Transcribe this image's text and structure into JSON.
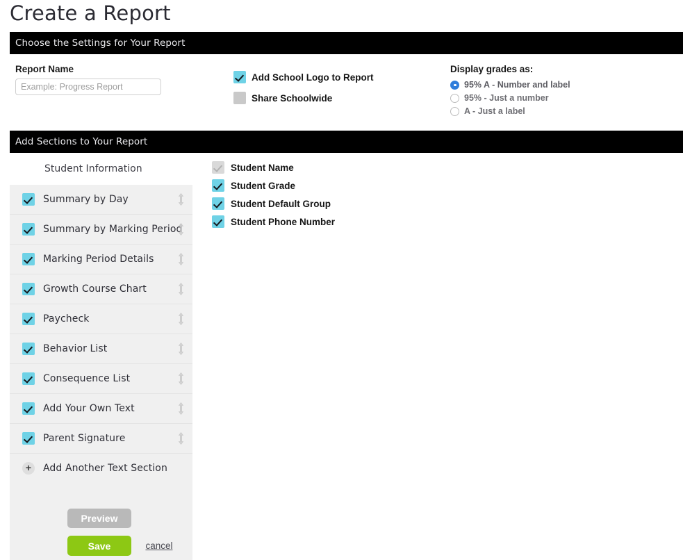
{
  "page": {
    "title": "Create a Report"
  },
  "settings_section": {
    "bar_title": "Choose the Settings for Your Report",
    "report_name_label": "Report Name",
    "report_name_value": "",
    "report_name_placeholder": "Example: Progress Report",
    "options": [
      {
        "label": "Add School Logo to Report",
        "checked": true
      },
      {
        "label": "Share Schoolwide",
        "checked": false
      }
    ],
    "grades": {
      "title": "Display grades as:",
      "options": [
        {
          "label": "95% A - Number and label",
          "selected": true
        },
        {
          "label": "95% - Just a number",
          "selected": false
        },
        {
          "label": "A - Just a label",
          "selected": false
        }
      ]
    }
  },
  "sections_section": {
    "bar_title": "Add Sections to Your Report",
    "sidebar_head": "Student Information",
    "items": [
      {
        "label": "Summary by Day",
        "checked": true
      },
      {
        "label": "Summary by Marking Period",
        "checked": true
      },
      {
        "label": "Marking Period Details",
        "checked": true
      },
      {
        "label": "Growth Course Chart",
        "checked": true
      },
      {
        "label": "Paycheck",
        "checked": true
      },
      {
        "label": "Behavior List",
        "checked": true
      },
      {
        "label": "Consequence List",
        "checked": true
      },
      {
        "label": "Add Your Own Text",
        "checked": true
      },
      {
        "label": "Parent Signature",
        "checked": true
      }
    ],
    "add_another_label": "Add Another Text Section",
    "add_another_icon": "plus-icon"
  },
  "fields_panel": {
    "fields": [
      {
        "label": "Student Name",
        "checked": true,
        "disabled": true
      },
      {
        "label": "Student Grade",
        "checked": true,
        "disabled": false
      },
      {
        "label": "Student Default Group",
        "checked": true,
        "disabled": false
      },
      {
        "label": "Student Phone Number",
        "checked": true,
        "disabled": false
      }
    ]
  },
  "actions": {
    "preview_label": "Preview",
    "save_label": "Save",
    "cancel_label": "cancel"
  },
  "colors": {
    "accent_cyan": "#6fd2e6",
    "save_green": "#8dc814",
    "preview_grey": "#b9b9b9",
    "radio_blue": "#2f7ddb",
    "bar_black": "#000000",
    "sidebar_grey": "#f0f0f0"
  }
}
